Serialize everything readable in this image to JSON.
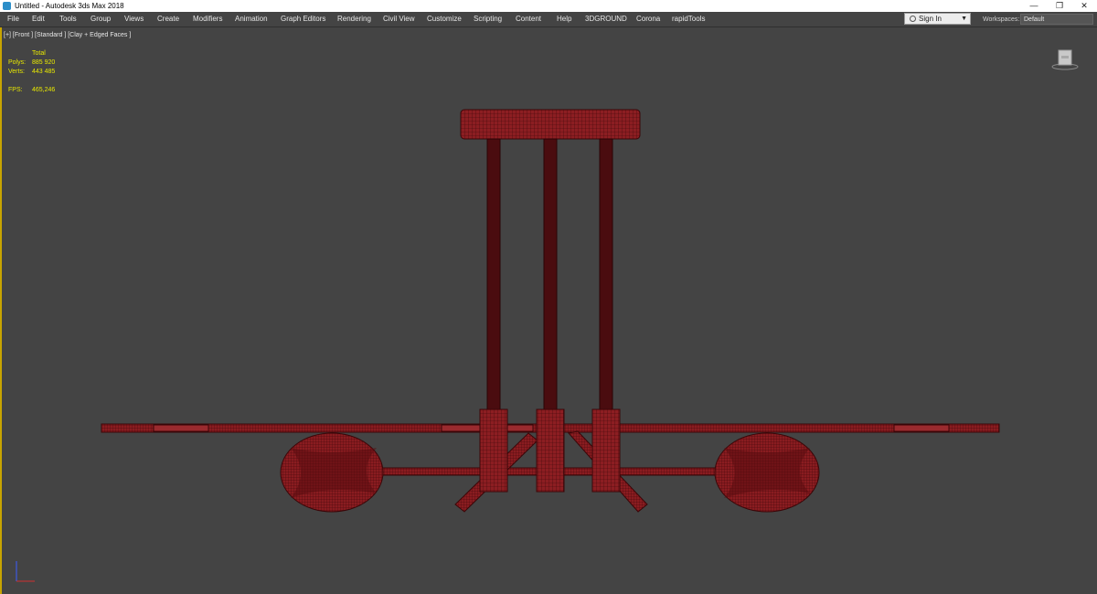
{
  "window": {
    "title": "Untitled - Autodesk 3ds Max 2018",
    "minimize": "—",
    "restore": "❐",
    "close": "✕"
  },
  "menu": {
    "items": [
      "File",
      "Edit",
      "Tools",
      "Group",
      "Views",
      "Create",
      "Modifiers",
      "Animation",
      "Graph Editors",
      "Rendering",
      "Civil View",
      "Customize",
      "Scripting",
      "Content",
      "Help",
      "3DGROUND",
      "Corona",
      "rapidTools"
    ],
    "sign_in": "Sign In",
    "workspaces_label": "Workspaces:",
    "workspace_value": "Default"
  },
  "viewport": {
    "label": "[+] [Front ] [Standard ] [Clay + Edged Faces ]",
    "stats": {
      "total_label": "Total",
      "polys_label": "Polys:",
      "polys_value": "885 920",
      "verts_label": "Verts:",
      "verts_value": "443 485",
      "fps_label": "FPS:",
      "fps_value": "465,246"
    }
  },
  "colors": {
    "viewport_bg": "#444444",
    "active_border": "#c8a400",
    "stats_text": "#e8e800",
    "model_fill": "#8c1e22",
    "model_wire": "#3a0608"
  }
}
